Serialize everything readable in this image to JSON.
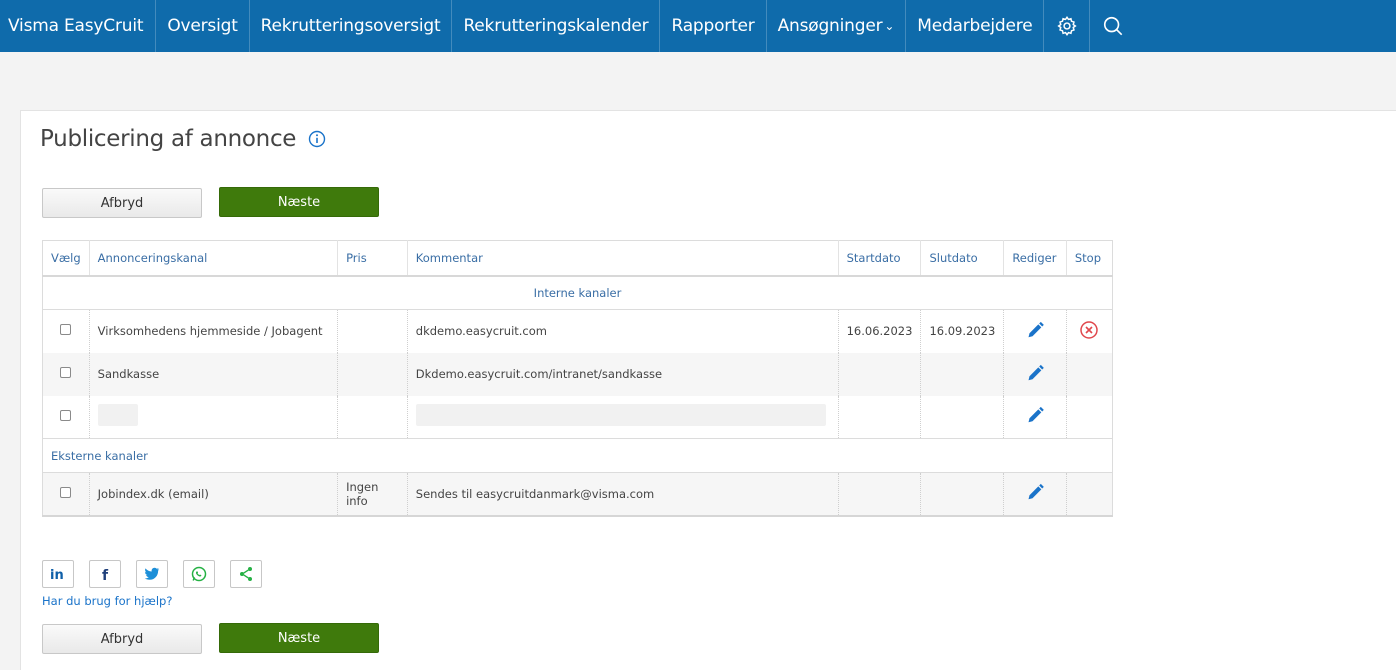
{
  "nav": {
    "brand": "Visma EasyCruit",
    "items": [
      "Oversigt",
      "Rekrutteringsoversigt",
      "Rekrutteringskalender",
      "Rapporter",
      "Ansøgninger",
      "Medarbejdere"
    ],
    "dropdown_caret": "⌄",
    "icons": [
      "gear-icon",
      "search-icon"
    ]
  },
  "page": {
    "title": "Publicering af annonce",
    "info_icon": "info-icon"
  },
  "buttons": {
    "cancel": "Afbryd",
    "next": "Næste"
  },
  "table": {
    "headers": [
      "Vælg",
      "Annonceringskanal",
      "Pris",
      "Kommentar",
      "Startdato",
      "Slutdato",
      "Rediger",
      "Stop"
    ],
    "internal_group": "Interne kanaler",
    "internal_rows": [
      {
        "channel": "Virksomhedens hjemmeside / Jobagent",
        "price": "",
        "comment": "dkdemo.easycruit.com",
        "start": "16.06.2023",
        "end": "16.09.2023",
        "edit_icon": "pencil-icon",
        "stop_icon": "close-circle-icon"
      },
      {
        "channel": "Sandkasse",
        "price": "",
        "comment": "Dkdemo.easycruit.com/intranet/sandkasse",
        "start": "",
        "end": "",
        "edit_icon": "pencil-icon",
        "stop_icon": ""
      },
      {
        "channel": "",
        "price": "",
        "comment": "",
        "start": "",
        "end": "",
        "edit_icon": "pencil-icon",
        "stop_icon": ""
      }
    ],
    "external_group": "Eksterne kanaler",
    "external_rows": [
      {
        "channel": "Jobindex.dk (email)",
        "price": "Ingen info",
        "comment": "Sendes til easycruitdanmark@visma.com",
        "start": "",
        "end": "",
        "edit_icon": "pencil-icon",
        "stop_icon": ""
      }
    ]
  },
  "social": {
    "icons": [
      "linkedin-icon",
      "facebook-icon",
      "twitter-icon",
      "whatsapp-icon",
      "share-icon"
    ],
    "help_link": "Har du brug for hjælp?"
  },
  "colors": {
    "nav_bg": "#0f6bab",
    "next_btn": "#3f7a0c",
    "link": "#3a6ea5",
    "pencil": "#1a73c9",
    "stop": "#e0474c",
    "whatsapp": "#25b144"
  }
}
